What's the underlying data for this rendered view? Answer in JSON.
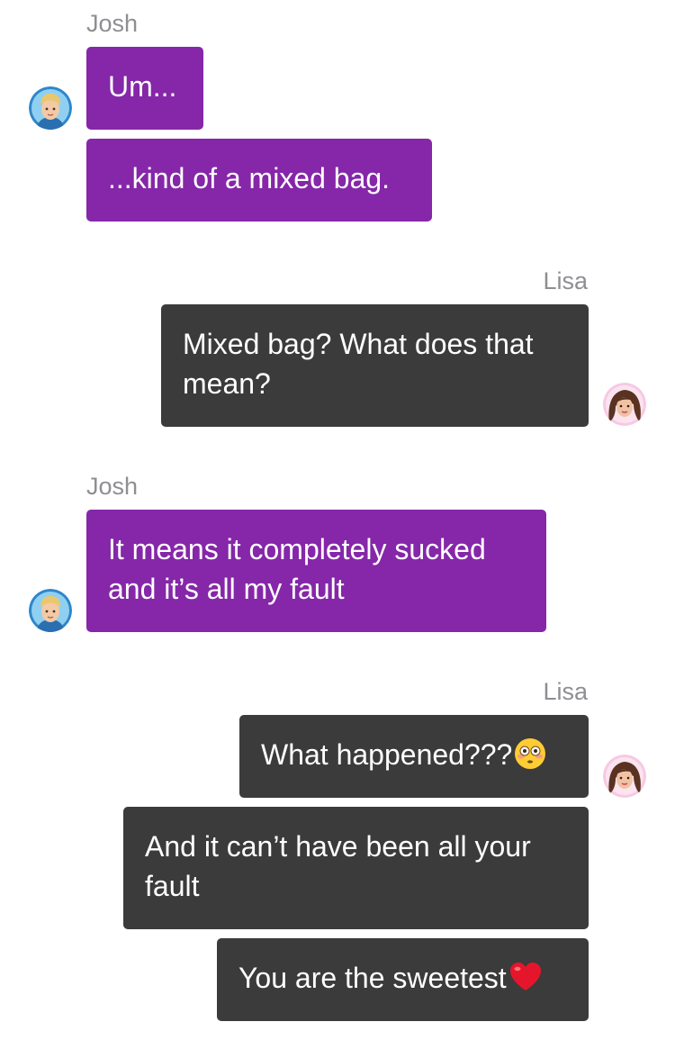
{
  "conversation": {
    "participants": {
      "josh": "Josh",
      "lisa": "Lisa"
    },
    "groups": [
      {
        "sender": "Josh",
        "messages": [
          "Um...",
          "...kind of a mixed bag."
        ]
      },
      {
        "sender": "Lisa",
        "messages": [
          "Mixed bag? What does that mean?"
        ]
      },
      {
        "sender": "Josh",
        "messages": [
          "It means it completely sucked and it’s all my fault"
        ]
      },
      {
        "sender": "Lisa",
        "messages": [
          "What happened???",
          "And it can’t have been all your fault",
          "You are the sweetest"
        ]
      }
    ],
    "emoji": {
      "flushed": "flushed-face-icon",
      "heart": "red-heart-icon"
    },
    "avatars": {
      "josh": "josh-avatar",
      "lisa": "lisa-avatar"
    }
  },
  "colors": {
    "incoming_bubble": "#8527a8",
    "outgoing_bubble": "#3b3b3b",
    "sender_name": "#8e8e93",
    "background": "#ffffff"
  }
}
